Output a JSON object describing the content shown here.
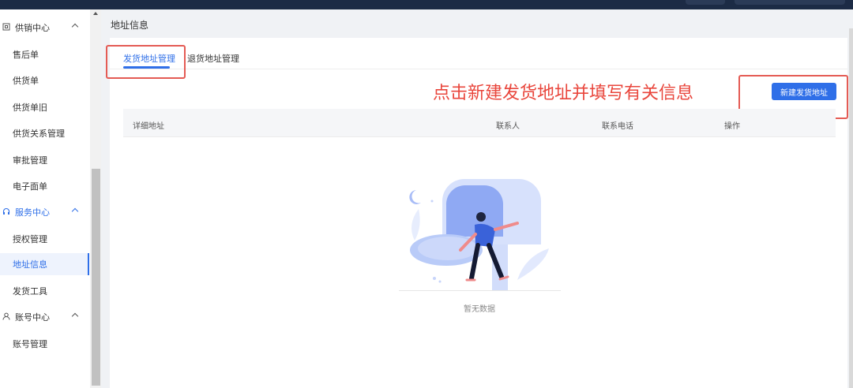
{
  "sidebar": {
    "groups": [
      {
        "label": "供销中心",
        "icon": "box-icon"
      },
      {
        "label": "服务中心",
        "icon": "headset-icon"
      },
      {
        "label": "账号中心",
        "icon": "user-icon"
      }
    ],
    "items": [
      {
        "label": "售后单"
      },
      {
        "label": "供货单"
      },
      {
        "label": "供货单旧"
      },
      {
        "label": "供货关系管理"
      },
      {
        "label": "审批管理"
      },
      {
        "label": "电子面单"
      },
      {
        "label": "授权管理"
      },
      {
        "label": "地址信息"
      },
      {
        "label": "发货工具"
      },
      {
        "label": "账号管理"
      }
    ],
    "active_item": "地址信息"
  },
  "page": {
    "title": "地址信息",
    "tabs": [
      {
        "label": "发货地址管理",
        "active": true
      },
      {
        "label": "退货地址管理",
        "active": false
      }
    ],
    "annotation": "点击新建发货地址并填写有关信息",
    "new_button": "新建发货地址",
    "table": {
      "columns": [
        "详细地址",
        "联系人",
        "联系电话",
        "操作"
      ],
      "rows": []
    },
    "empty_text": "暂无数据"
  },
  "colors": {
    "primary": "#2f6fe8",
    "highlight_box": "#e45b54",
    "annotation": "#e9463c"
  }
}
